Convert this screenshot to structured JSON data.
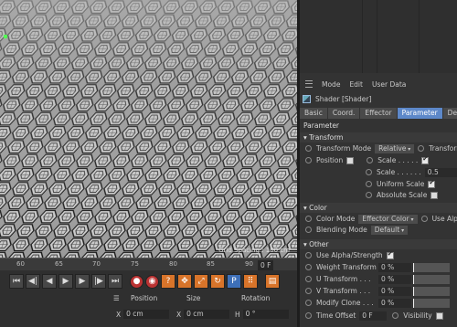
{
  "viewport": {
    "grid_spacing": "Grid Spacing : 100 cm"
  },
  "attr_manager": {
    "menu": [
      "Mode",
      "Edit",
      "User Data"
    ],
    "title": "Shader [Shader]",
    "tabs": [
      "Basic",
      "Coord.",
      "Effector",
      "Parameter",
      "Deform"
    ],
    "active_tab": "Parameter",
    "section": "Parameter",
    "transform": {
      "header": "▾ Transform",
      "mode_label": "Transform Mode",
      "mode_value": "Relative",
      "transform2": "Transform",
      "position": "Position",
      "scale": "Scale . . . . .",
      "scale2": "Scale . . . . . .",
      "scale_value": "0.5",
      "uniform_scale": "Uniform Scale",
      "absolute_scale": "Absolute Scale"
    },
    "color": {
      "header": "▾ Color",
      "mode_label": "Color Mode",
      "mode_value": "Effector Color",
      "use_alpha": "Use Alpha/",
      "blending_label": "Blending Mode",
      "blending_value": "Default"
    },
    "other": {
      "header": "▾ Other",
      "use_alpha_strength": "Use Alpha/Strength",
      "weight": "Weight Transform",
      "weight_value": "0 %",
      "u": "U Transform . . .",
      "u_value": "0 %",
      "v": "V Transform . . .",
      "v_value": "0 %",
      "clone": "Modify Clone . . .",
      "clone_value": "0 %",
      "time_offset": "Time Offset",
      "time_value": "0 F",
      "visibility": "Visibility"
    }
  },
  "timeline": {
    "ticks": [
      "60",
      "65",
      "70",
      "75",
      "80",
      "85",
      "90"
    ],
    "frame": "0 F"
  },
  "coords": {
    "position": "Position",
    "size": "Size",
    "rotation": "Rotation",
    "x_pos": "0 cm",
    "x_size": "0 cm",
    "h_rot": "0 °",
    "x": "X",
    "h": "H"
  }
}
